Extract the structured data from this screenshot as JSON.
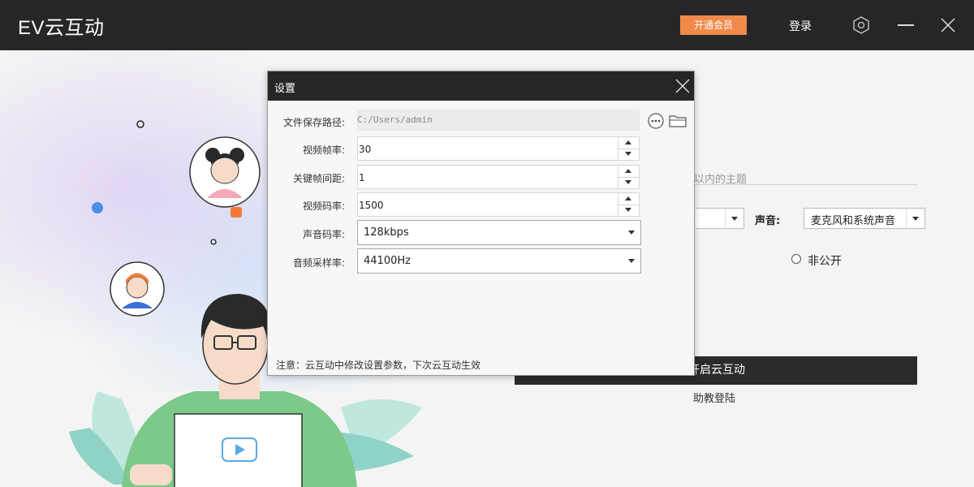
{
  "app": {
    "title": "EV云互动",
    "vip_button": "开通会员",
    "login": "登录"
  },
  "main": {
    "topic_placeholder": "以内的主题",
    "audio_label": "声音:",
    "audio_value": "麦克风和系统声音",
    "radio_private_label": "非公开",
    "start_button": "开启云互动",
    "assistant_login": "助教登陆"
  },
  "dialog": {
    "title": "设置",
    "path_label": "文件保存路径:",
    "path_value": "C:/Users/admin",
    "fps_label": "视频帧率:",
    "fps_value": "30",
    "keyframe_label": "关键帧间距:",
    "keyframe_value": "1",
    "bitrate_label": "视频码率:",
    "bitrate_value": "1500",
    "audio_bitrate_label": "声音码率:",
    "audio_bitrate_value": "128kbps",
    "sample_rate_label": "音频采样率:",
    "sample_rate_value": "44100Hz",
    "note": "注意：云互动中修改设置参数，下次云互动生效"
  },
  "icons": {
    "settings": "hexagon-settings-icon",
    "minimize": "minimize-icon",
    "close": "close-icon",
    "more": "more-dots-icon",
    "folder": "folder-icon"
  },
  "colors": {
    "titlebar": "#262626",
    "vip_button": "#f08a4b",
    "dialog_header": "#262626",
    "start_button": "#2b2b2b"
  }
}
